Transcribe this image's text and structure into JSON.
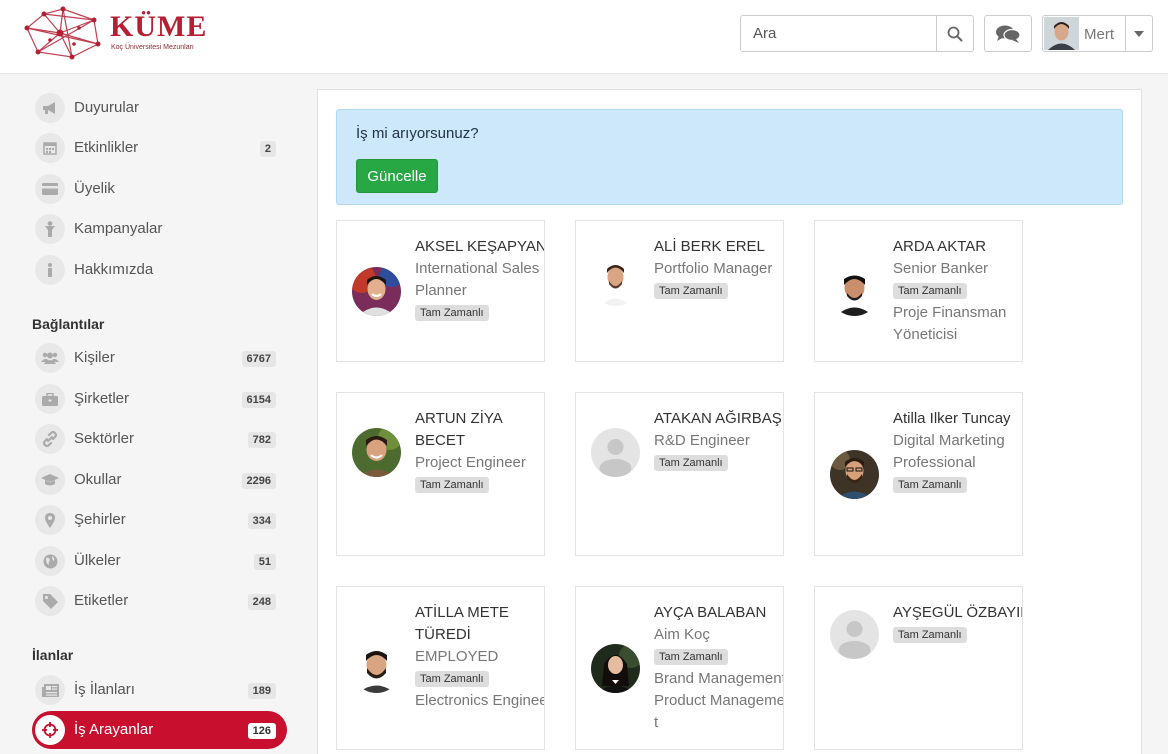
{
  "brand": {
    "title": "KÜME",
    "subtitle": "Koç Üniversitesi Mezunları"
  },
  "header": {
    "search_placeholder": "Ara",
    "user_name": "Mert"
  },
  "sidebar": {
    "main_items": [
      {
        "label": "Duyurular",
        "icon": "megaphone-icon"
      },
      {
        "label": "Etkinlikler",
        "icon": "calendar-icon",
        "badge": "2"
      },
      {
        "label": "Üyelik",
        "icon": "credit-card-icon"
      },
      {
        "label": "Kampanyalar",
        "icon": "child-icon"
      },
      {
        "label": "Hakkımızda",
        "icon": "info-icon"
      }
    ],
    "connections_title": "Bağlantılar",
    "connection_items": [
      {
        "label": "Kişiler",
        "icon": "users-icon",
        "badge": "6767"
      },
      {
        "label": "Şirketler",
        "icon": "briefcase-icon",
        "badge": "6154"
      },
      {
        "label": "Sektörler",
        "icon": "link-icon",
        "badge": "782"
      },
      {
        "label": "Okullar",
        "icon": "graduation-cap-icon",
        "badge": "2296"
      },
      {
        "label": "Şehirler",
        "icon": "map-marker-icon",
        "badge": "334"
      },
      {
        "label": "Ülkeler",
        "icon": "globe-icon",
        "badge": "51"
      },
      {
        "label": "Etiketler",
        "icon": "tag-icon",
        "badge": "248"
      }
    ],
    "listings_title": "İlanlar",
    "listing_items": [
      {
        "label": "İş İlanları",
        "icon": "newspaper-icon",
        "badge": "189"
      },
      {
        "label": "İş Arayanlar",
        "icon": "crosshair-icon",
        "badge": "126",
        "active": true
      }
    ]
  },
  "alert": {
    "text": "İş mi arıyorsunuz?",
    "button": "Güncelle"
  },
  "cards": [
    {
      "name": "AKSEL KEŞAPYAN",
      "lines_before": [
        "International Sales Planner"
      ],
      "tag": "Tam Zamanlı",
      "lines_after": []
    },
    {
      "name": "ALİ BERK EREL",
      "lines_before": [
        "Portfolio Manager"
      ],
      "tag": "Tam Zamanlı",
      "lines_after": []
    },
    {
      "name": "ARDA AKTAR",
      "lines_before": [
        "Senior Banker"
      ],
      "tag": "Tam Zamanlı",
      "lines_after": [
        "Proje Finansman Yöneticisi"
      ]
    },
    {
      "name": "ARTUN ZİYA BECET",
      "lines_before": [
        "Project Engineer"
      ],
      "tag": "Tam Zamanlı",
      "lines_after": []
    },
    {
      "name": "ATAKAN AĞIRBAŞ",
      "lines_before": [
        "R&D Engineer"
      ],
      "tag": "Tam Zamanlı",
      "lines_after": []
    },
    {
      "name": "Atilla Ilker Tuncay",
      "lines_before": [
        "Digital Marketing Professional"
      ],
      "tag": "Tam Zamanlı",
      "lines_after": []
    },
    {
      "name": "ATİLLA METE TÜREDİ",
      "lines_before": [
        "EMPLOYED"
      ],
      "tag": "Tam Zamanlı",
      "lines_after": [
        "Electronics Engineer"
      ]
    },
    {
      "name": "AYÇA BALABAN",
      "lines_before": [
        "Aim Koç"
      ],
      "tag": "Tam Zamanlı",
      "lines_after": [
        "Brand Management,Product Management"
      ]
    },
    {
      "name": "AYŞEGÜL ÖZBAYIR",
      "lines_before": [],
      "tag": "Tam Zamanlı",
      "lines_after": []
    }
  ],
  "colors": {
    "accent": "#c8102e",
    "success": "#28a745",
    "alert_bg": "#cde8fb"
  }
}
